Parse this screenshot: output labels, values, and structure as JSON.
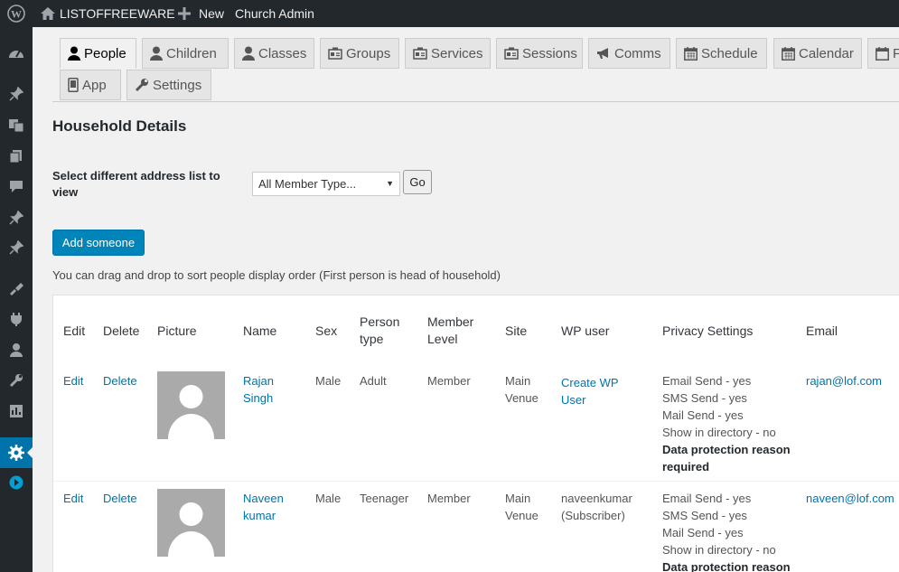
{
  "topbar": {
    "wp_icon": "wordpress-logo-icon",
    "site_name": "LISTOFFREEWARE",
    "new_label": "New",
    "plugin_label": "Church Admin"
  },
  "sidebar": {
    "icons": [
      "dashboard-icon",
      "pin-icon",
      "media-icon",
      "pages-icon",
      "comments-icon",
      "pin-icon",
      "pin-icon",
      "appearance-icon",
      "plugins-icon",
      "users-icon",
      "tools-icon",
      "settings-icon",
      "gear-icon",
      "collapse-icon"
    ]
  },
  "tabs": [
    {
      "label": "People",
      "icon": "person-icon"
    },
    {
      "label": "Children",
      "icon": "person-icon"
    },
    {
      "label": "Classes",
      "icon": "person-icon"
    },
    {
      "label": "Groups",
      "icon": "id-card-icon"
    },
    {
      "label": "Services",
      "icon": "id-card-icon"
    },
    {
      "label": "Sessions",
      "icon": "id-card-icon"
    },
    {
      "label": "Comms",
      "icon": "megaphone-icon"
    },
    {
      "label": "Schedule",
      "icon": "calendar-icon"
    },
    {
      "label": "Calendar",
      "icon": "calendar-icon"
    },
    {
      "label": "F",
      "icon": "calendar-icon"
    },
    {
      "label": "App",
      "icon": "phone-icon"
    },
    {
      "label": "Settings",
      "icon": "wrench-icon"
    }
  ],
  "page": {
    "title": "Household Details",
    "select_label": "Select different address list to view",
    "select_value": "All Member Type...",
    "go_label": "Go",
    "add_label": "Add someone",
    "hint": "You can drag and drop to sort people display order (First person is head of household)"
  },
  "table": {
    "headers": {
      "edit": "Edit",
      "delete": "Delete",
      "picture": "Picture",
      "name": "Name",
      "sex": "Sex",
      "person_type_1": "Person",
      "person_type_2": "type",
      "member_level_1": "Member",
      "member_level_2": "Level",
      "site": "Site",
      "wp_user": "WP user",
      "privacy": "Privacy Settings",
      "email": "Email"
    },
    "rows": [
      {
        "edit": "Edit",
        "delete": "Delete",
        "name_1": "Rajan",
        "name_2": "Singh",
        "sex": "Male",
        "person_type": "Adult",
        "member_level": "Member",
        "site_1": "Main",
        "site_2": "Venue",
        "wp_user_1": "Create WP",
        "wp_user_2": "User",
        "privacy": [
          "Email Send - yes",
          "SMS Send - yes",
          "Mail Send - yes",
          "Show in directory - no"
        ],
        "privacy_bold_1": "Data protection reason",
        "privacy_bold_2": "required",
        "email": "rajan@lof.com"
      },
      {
        "edit": "Edit",
        "delete": "Delete",
        "name_1": "Naveen",
        "name_2": "kumar",
        "sex": "Male",
        "person_type": "Teenager",
        "member_level": "Member",
        "site_1": "Main",
        "site_2": "Venue",
        "wp_user_1": "naveenkumar",
        "wp_user_2": "(Subscriber)",
        "privacy": [
          "Email Send - yes",
          "SMS Send - yes",
          "Mail Send - yes",
          "Show in directory - no"
        ],
        "privacy_bold_1": "Data protection reason",
        "email": "naveen@lof.com"
      }
    ]
  }
}
